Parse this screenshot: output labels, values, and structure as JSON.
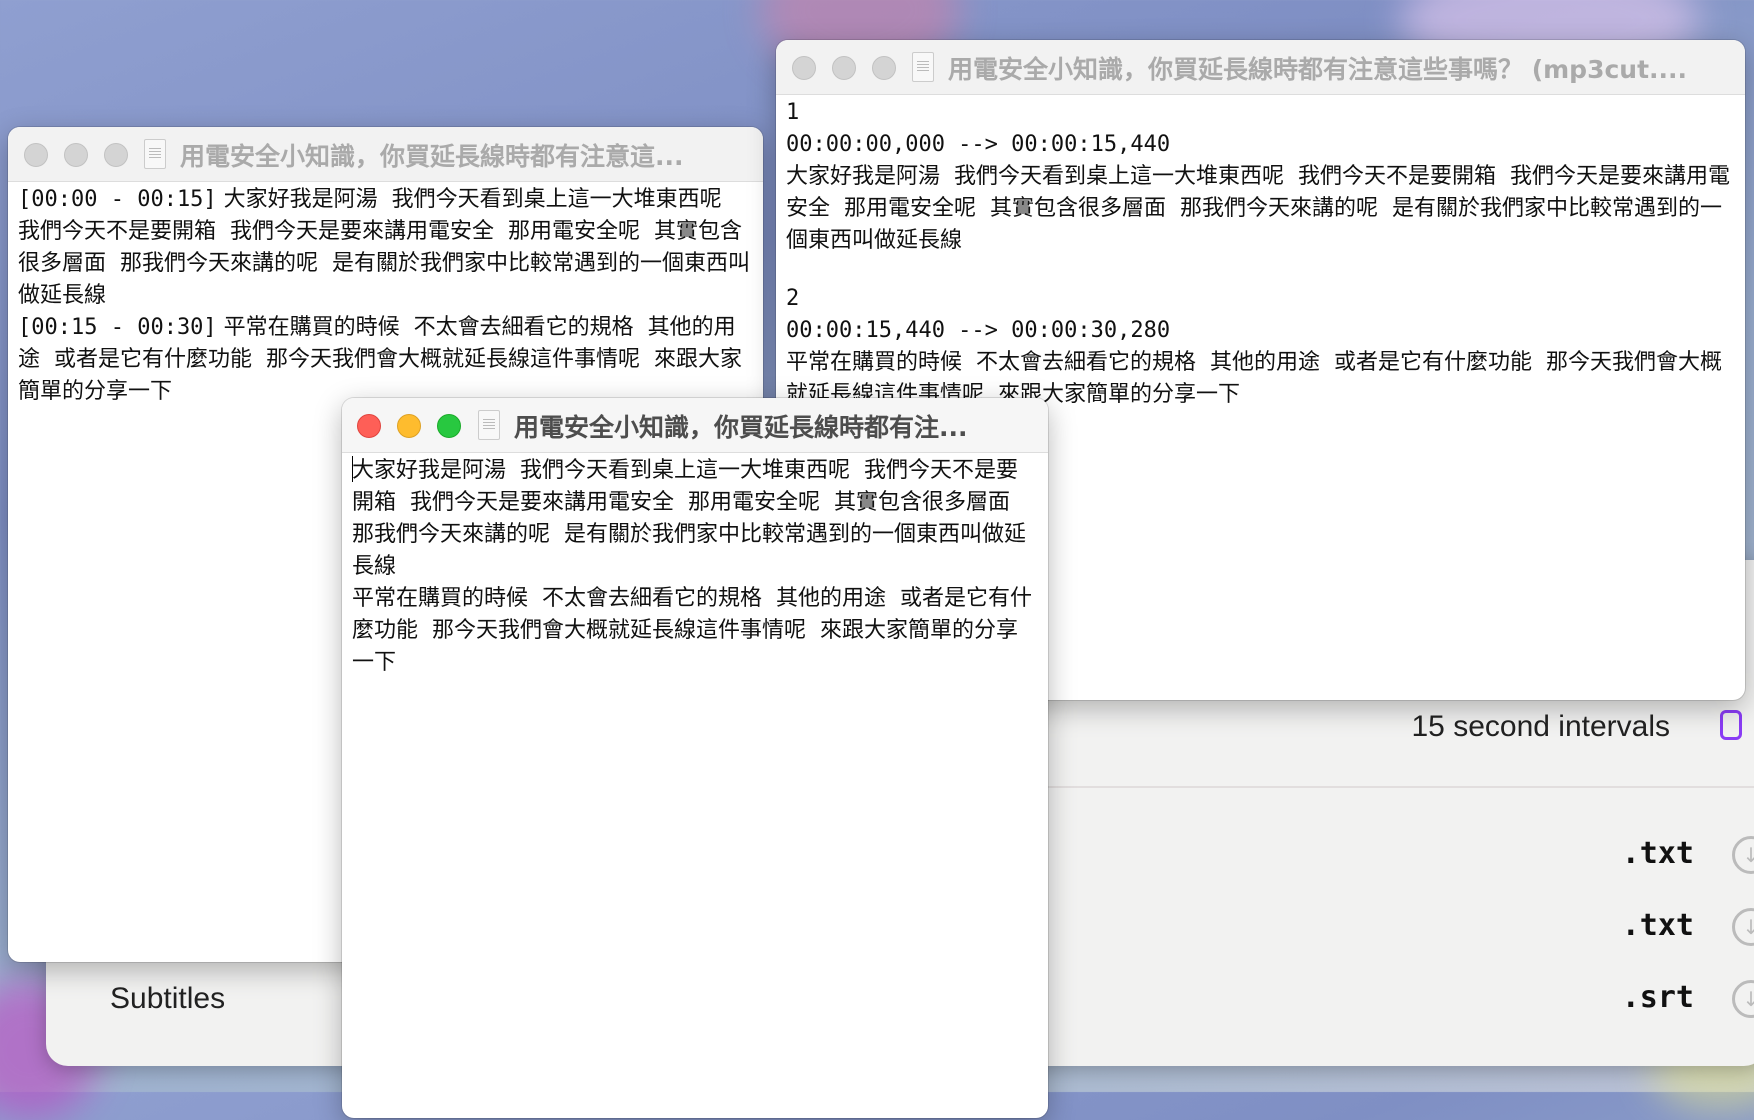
{
  "background_app": {
    "interval_label": "15 second intervals",
    "section_label": "Subtitles",
    "formats": [
      ".txt",
      ".txt",
      ".srt"
    ],
    "accent_color": "#8a3cf5"
  },
  "window_timestamped": {
    "title": "用電安全小知識，你買延長線時都有注意這...",
    "lines": [
      {
        "time": "[00:00 - 00:15]",
        "text": " 大家好我是阿湯  我們今天看到桌上這一大堆東西呢  我們今天不是要開箱  我們今天是要來講用電安全  那用電安全呢  其實包含很多層面  那我們今天來講的呢  是有關於我們家中比較常遇到的一個東西叫做延長線"
      },
      {
        "time": "[00:15 - 00:30]",
        "text": " 平常在購買的時候  不太會去細看它的規格  其他的用途  或者是它有什麼功能  那今天我們會大概就延長線這件事情呢  來跟大家簡單的分享一下"
      }
    ]
  },
  "window_srt": {
    "title": "用電安全小知識，你買延長線時都有注意這些事嗎？ (mp3cut....",
    "entries": [
      {
        "index": "1",
        "time": "00:00:00,000 --> 00:00:15,440",
        "text": "大家好我是阿湯  我們今天看到桌上這一大堆東西呢  我們今天不是要開箱  我們今天是要來講用電安全  那用電安全呢  其實包含很多層面  那我們今天來講的呢  是有關於我們家中比較常遇到的一個東西叫做延長線"
      },
      {
        "index": "2",
        "time": "00:00:15,440 --> 00:00:30,280",
        "text": "平常在購買的時候  不太會去細看它的規格  其他的用途  或者是它有什麼功能  那今天我們會大概就延長線這件事情呢  來跟大家簡單的分享一下"
      }
    ]
  },
  "window_plain": {
    "title": "用電安全小知識，你買延長線時都有注...",
    "paragraphs": [
      "大家好我是阿湯  我們今天看到桌上這一大堆東西呢  我們今天不是要開箱  我們今天是要來講用電安全  那用電安全呢  其實包含很多層面  那我們今天來講的呢  是有關於我們家中比較常遇到的一個東西叫做延長線",
      "平常在購買的時候  不太會去細看它的規格  其他的用途  或者是它有什麼功能  那今天我們會大概就延長線這件事情呢  來跟大家簡單的分享一下"
    ]
  }
}
